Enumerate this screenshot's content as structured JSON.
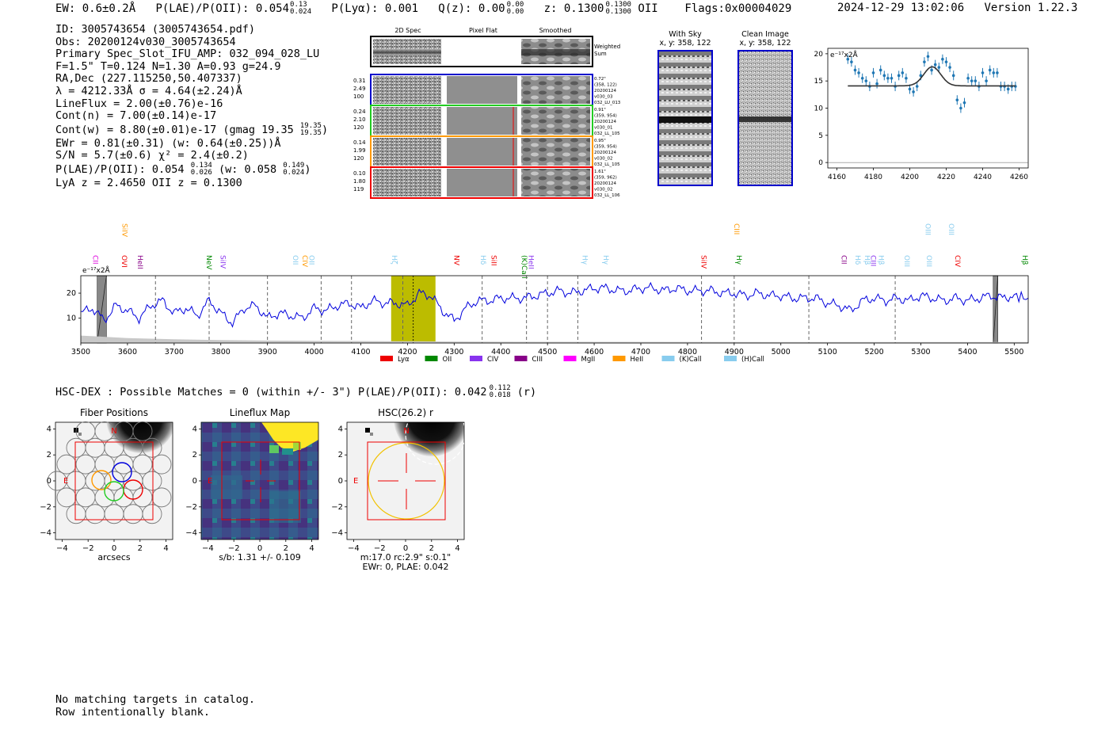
{
  "header": {
    "ew": "EW: 0.6±0.2Å",
    "plae": "P(LAE)/P(OII): 0.054",
    "plae_sup": "0.13",
    "plae_sub": "0.024",
    "plya": "P(Lyα): 0.001",
    "qz": "Q(z): 0.00",
    "qz_sup": "0.00",
    "qz_sub": "0.00",
    "z": "z: 0.1300",
    "z_sup": "0.1300",
    "z_sub": "0.1300",
    "z_line": "OII",
    "flags": "Flags:0x00004029",
    "timestamp": "2024-12-29 13:02:06",
    "version": "Version 1.22.3"
  },
  "info": {
    "id": "ID: 3005743654 (3005743654.pdf)",
    "obs": "Obs: 20200124v030_3005743654",
    "primary": "Primary Spec_Slot_IFU_AMP: 032_094_028_LU",
    "fparams": "F=1.5\"  T=0.124  N=1.30  A=0.93  g=24.9",
    "radec": "RA,Dec (227.115250,50.407337)",
    "lambda": "λ = 4212.33Å  σ = 4.64(±2.24)Å",
    "lineflux": "LineFlux = 2.00(±0.76)e-16",
    "contn": "Cont(n) = 7.00(±0.14)e-17",
    "contw": "Cont(w) = 8.80(±0.01)e-17 (gmag 19.35",
    "contw_sup": "19.35",
    "contw_sub": "19.35",
    "contw_end": ")",
    "ewr": "EWr = 0.81(±0.31) (w: 0.64(±0.25))Å",
    "sn": "S/N = 5.7(±0.6)  χ² = 2.4(±0.2)",
    "plae": "P(LAE)/P(OII): 0.054",
    "plae_sup": "0.134",
    "plae_sub": "0.026",
    "plae_w": "(w: 0.058",
    "plae_w_sup": "0.149",
    "plae_w_sub": "0.024",
    "plae_w_end": ")",
    "lyaz": "LyA z = 2.4650  OII z = 0.1300"
  },
  "spec2d": {
    "col_titles": [
      "2D Spec",
      "Pixel Flat",
      "Smoothed"
    ],
    "weighted_label": "Weighted\nSum",
    "rows": [
      {
        "left": [
          "0.31",
          "2.49",
          "100"
        ],
        "right": [
          "0.72\"",
          "(358, 122)",
          "20200124",
          "v030_03",
          "032_LU_013"
        ],
        "color": "#0000cc"
      },
      {
        "left": [
          "0.24",
          "2.10",
          "120"
        ],
        "right": [
          "0.91\"",
          "(359, 954)",
          "20200124",
          "v030_01",
          "032_LL_105"
        ],
        "color": "#22cc22"
      },
      {
        "left": [
          "0.14",
          "1.99",
          "120"
        ],
        "right": [
          "0.95\"",
          "(359, 954)",
          "20200124",
          "v030_02",
          "032_LL_105"
        ],
        "color": "#ff9900"
      },
      {
        "left": [
          "0.10",
          "1.80",
          "119"
        ],
        "right": [
          "1.61\"",
          "(359, 962)",
          "20200124",
          "v030_02",
          "032_LL_106"
        ],
        "color": "#ee0000"
      }
    ]
  },
  "stamps": {
    "with_sky_title": "With Sky",
    "with_sky_coords": "x, y: 358, 122",
    "clean_title": "Clean Image",
    "clean_coords": "x, y: 358, 122"
  },
  "zoom_chart": {
    "unit": "e⁻¹⁷x2Å"
  },
  "full_spectrum": {
    "unit": "e⁻¹⁷x2Å",
    "line_labels": [
      {
        "text": "CII",
        "x": 3526,
        "color": "#dd00dd",
        "row": 1
      },
      {
        "text": "SiIV",
        "x": 3589,
        "color": "#ff9900",
        "row": 0
      },
      {
        "text": "OVI",
        "x": 3588,
        "color": "#ee0000",
        "row": 1
      },
      {
        "text": "HeII",
        "x": 3622,
        "color": "#880088",
        "row": 1
      },
      {
        "text": "NeV",
        "x": 3770,
        "color": "#008800",
        "row": 1
      },
      {
        "text": "SiIV",
        "x": 3800,
        "color": "#8833ee",
        "row": 1
      },
      {
        "text": "OII",
        "x": 3955,
        "color": "#88ccee",
        "row": 1
      },
      {
        "text": "CIV",
        "x": 3975,
        "color": "#ff9900",
        "row": 1
      },
      {
        "text": "OII",
        "x": 3990,
        "color": "#88ccee",
        "row": 1
      },
      {
        "text": "Hζ",
        "x": 4167,
        "color": "#88ccee",
        "row": 1
      },
      {
        "text": "NV",
        "x": 4300,
        "color": "#ee0000",
        "row": 1
      },
      {
        "text": "Hδ",
        "x": 4357,
        "color": "#88ccee",
        "row": 1
      },
      {
        "text": "SiII",
        "x": 4380,
        "color": "#ee0000",
        "row": 1
      },
      {
        "text": "(K)Call",
        "x": 4445,
        "color": "#008800",
        "row": 1
      },
      {
        "text": "HeII",
        "x": 4460,
        "color": "#8833ee",
        "row": 1
      },
      {
        "text": "Hγ",
        "x": 4575,
        "color": "#88ccee",
        "row": 1
      },
      {
        "text": "Hγ",
        "x": 4620,
        "color": "#88ccee",
        "row": 1
      },
      {
        "text": "SiIV",
        "x": 4830,
        "color": "#ee0000",
        "row": 1
      },
      {
        "text": "CIII",
        "x": 4900,
        "color": "#ff9900",
        "row": 0
      },
      {
        "text": "Hγ",
        "x": 4905,
        "color": "#008800",
        "row": 1
      },
      {
        "text": "CII",
        "x": 5130,
        "color": "#880088",
        "row": 1
      },
      {
        "text": "Hδ",
        "x": 5160,
        "color": "#88ccee",
        "row": 1
      },
      {
        "text": "Hβ",
        "x": 5180,
        "color": "#88ccee",
        "row": 1
      },
      {
        "text": "CIII",
        "x": 5193,
        "color": "#8833ee",
        "row": 1
      },
      {
        "text": "Hβ",
        "x": 5210,
        "color": "#88ccee",
        "row": 1
      },
      {
        "text": "OIII",
        "x": 5265,
        "color": "#88ccee",
        "row": 1
      },
      {
        "text": "OIII",
        "x": 5310,
        "color": "#88ccee",
        "row": 0
      },
      {
        "text": "OIII",
        "x": 5313,
        "color": "#88ccee",
        "row": 1
      },
      {
        "text": "OIII",
        "x": 5360,
        "color": "#88ccee",
        "row": 0
      },
      {
        "text": "CIV",
        "x": 5374,
        "color": "#ee0000",
        "row": 1
      },
      {
        "text": "Hβ",
        "x": 5518,
        "color": "#008800",
        "row": 1
      }
    ],
    "legend": [
      {
        "label": "Lyα",
        "color": "#ee0000"
      },
      {
        "label": "OII",
        "color": "#008800"
      },
      {
        "label": "CIV",
        "color": "#8833ee"
      },
      {
        "label": "CIII",
        "color": "#880088"
      },
      {
        "label": "MgII",
        "color": "#ff00ff"
      },
      {
        "label": "HeII",
        "color": "#ff9900"
      },
      {
        "label": "(K)Call",
        "color": "#88ccee"
      },
      {
        "label": "(H)Call",
        "color": "#88ccee"
      }
    ]
  },
  "hsc": {
    "title_line": "HSC-DEX : Possible Matches = 0 (within +/- 3\")  P(LAE)/P(OII): 0.042",
    "sup": "0.112",
    "sub": "0.018",
    "band": "(r)",
    "panel1_title": "Fiber Positions",
    "panel2_title": "Lineflux Map",
    "panel3_title": "HSC(26.2) r",
    "panel1_xlabel": "arcsecs",
    "panel2_xlabel": "s/b: 1.31 +/- 0.109",
    "panel3_xlabel1": "m:17.0 rc:2.9\"  s:0.1\"",
    "panel3_xlabel2": "EWr: 0, PLAE: 0.042",
    "north": "N",
    "east": "E"
  },
  "footer": {
    "line1": "No matching targets in catalog.",
    "line2": "Row intentionally blank."
  },
  "chart_data": [
    {
      "type": "scatter",
      "title": "",
      "ylabel": "e⁻¹⁷x2Å",
      "xlim": [
        4155,
        4265
      ],
      "ylim": [
        -1,
        21
      ],
      "xticks": [
        4160,
        4180,
        4200,
        4220,
        4240,
        4260
      ],
      "yticks": [
        0,
        5,
        10,
        15,
        20
      ],
      "x": [
        4166,
        4168,
        4170,
        4172,
        4174,
        4176,
        4178,
        4180,
        4182,
        4184,
        4186,
        4188,
        4190,
        4192,
        4194,
        4196,
        4198,
        4200,
        4202,
        4204,
        4206,
        4208,
        4210,
        4212,
        4214,
        4216,
        4218,
        4220,
        4222,
        4224,
        4226,
        4228,
        4230,
        4232,
        4234,
        4236,
        4238,
        4240,
        4242,
        4244,
        4246,
        4248,
        4250,
        4252,
        4254,
        4256,
        4258
      ],
      "values": [
        19,
        18.5,
        17,
        16.5,
        15.5,
        15,
        14,
        16.5,
        14.5,
        17,
        16,
        15.5,
        15.5,
        14,
        16,
        16.5,
        15.5,
        13.5,
        13,
        14,
        16,
        18.5,
        19.5,
        17,
        18,
        17.5,
        19,
        18.5,
        17.5,
        16,
        11.5,
        10,
        11,
        15.5,
        15,
        15,
        14,
        16.5,
        15,
        17,
        16.5,
        16.5,
        14,
        14,
        13.5,
        14,
        14
      ],
      "fit": {
        "continuum": 14.1,
        "peak_x": 4212.33,
        "amplitude": 3.5,
        "sigma": 4.64,
        "x_range": [
          4166,
          4258
        ]
      }
    },
    {
      "type": "line",
      "title": "",
      "ylabel": "e⁻¹⁷x2Å",
      "xlim": [
        3500,
        5530
      ],
      "ylim": [
        0,
        27
      ],
      "xticks": [
        3500,
        3600,
        3700,
        3800,
        3900,
        4000,
        4100,
        4200,
        4300,
        4400,
        4500,
        4600,
        4700,
        4800,
        4900,
        5000,
        5100,
        5200,
        5300,
        5400,
        5500
      ],
      "yticks": [
        10,
        20
      ],
      "series": [
        {
          "x": [
            3500,
            3525,
            3550,
            3575,
            3600,
            3625,
            3650,
            3675,
            3700,
            3725,
            3750,
            3775,
            3800,
            3825,
            3850,
            3875,
            3900,
            3925,
            3950,
            3975,
            4000,
            4025,
            4050,
            4075,
            4100,
            4125,
            4150,
            4175,
            4200,
            4225,
            4250,
            4275,
            4300,
            4325,
            4350,
            4375,
            4400,
            4425,
            4450,
            4475,
            4500,
            4525,
            4550,
            4575,
            4600,
            4625,
            4650,
            4675,
            4700,
            4725,
            4750,
            4775,
            4800,
            4825,
            4850,
            4875,
            4900,
            4925,
            4950,
            4975,
            5000,
            5025,
            5050,
            5075,
            5100,
            5125,
            5150,
            5175,
            5200,
            5225,
            5250,
            5275,
            5300,
            5325,
            5350,
            5375,
            5400,
            5425,
            5450,
            5475,
            5500,
            5530
          ],
          "values": [
            12,
            14,
            9,
            15,
            13,
            10,
            15,
            17,
            12,
            14,
            11,
            17,
            12,
            8,
            14,
            15,
            10,
            12,
            11,
            10,
            14,
            13,
            15,
            16,
            14,
            17,
            16,
            16,
            15,
            20,
            19,
            13,
            9,
            14,
            17,
            17,
            18,
            18,
            18,
            19,
            20,
            21,
            20,
            21,
            22,
            22,
            21,
            21,
            22,
            22,
            21,
            22,
            21,
            21,
            21,
            20,
            20,
            19,
            20,
            19,
            19,
            18,
            18,
            18,
            16,
            15,
            13,
            17,
            18,
            17,
            18,
            17,
            19,
            18,
            17,
            18,
            17,
            18,
            19,
            18,
            19,
            18
          ]
        }
      ],
      "sky_x": [
        3500,
        3550,
        3600,
        3700,
        3800,
        3900,
        4000,
        4100,
        4200,
        4300,
        4400,
        5000,
        5530
      ],
      "sky_values": [
        3,
        2.5,
        2,
        1.5,
        1.2,
        1,
        0.9,
        0.8,
        0.7,
        0.6,
        0.5,
        0.4,
        0.4
      ],
      "dashed_x": [
        3660,
        3775,
        3900,
        4015,
        4080,
        4190,
        4360,
        4455,
        4500,
        4565,
        4830,
        4900,
        5060,
        5245
      ],
      "highlight": [
        4165,
        4260
      ],
      "detection_x": 4212.33,
      "masked": [
        [
          3535,
          3555
        ],
        [
          5455,
          5465
        ]
      ]
    }
  ]
}
